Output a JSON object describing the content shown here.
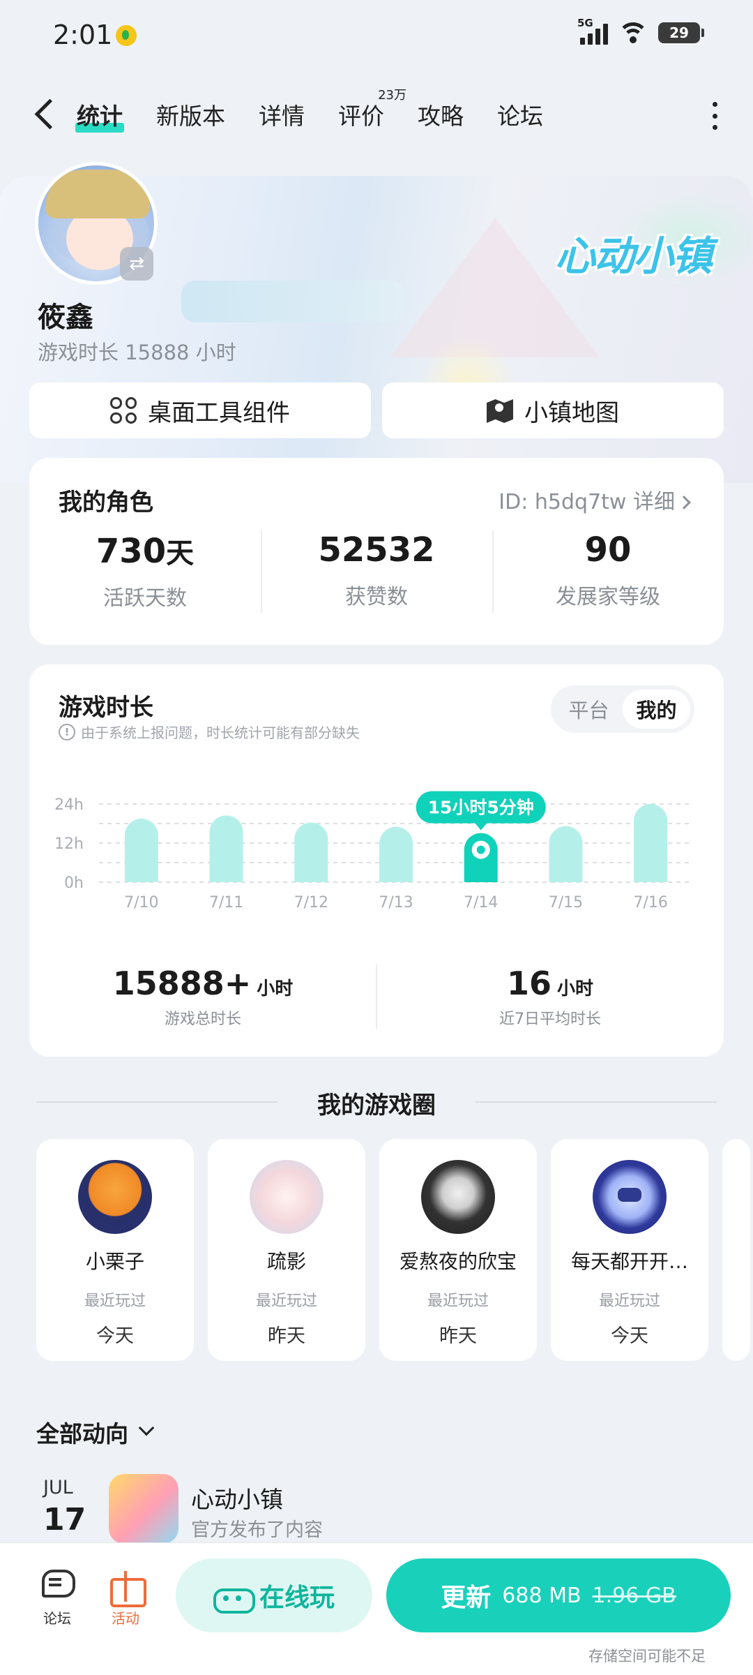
{
  "status_bar": {
    "time": "2:01",
    "network": "5G",
    "battery": "29"
  },
  "nav": {
    "tabs": [
      {
        "label": "统计",
        "active": true
      },
      {
        "label": "新版本"
      },
      {
        "label": "详情"
      },
      {
        "label": "评价",
        "badge": "23万"
      },
      {
        "label": "攻略"
      },
      {
        "label": "论坛"
      }
    ]
  },
  "profile": {
    "name": "筱鑫",
    "playtime": "游戏时长 15888 小时",
    "game_logo": "心动小镇"
  },
  "quick_actions": {
    "widgets": "桌面工具组件",
    "map": "小镇地图"
  },
  "role": {
    "title": "我的角色",
    "id_link": "ID: h5dq7tw 详细",
    "stats": [
      {
        "value": "730",
        "unit": "天",
        "label": "活跃天数"
      },
      {
        "value": "52532",
        "unit": "",
        "label": "获赞数"
      },
      {
        "value": "90",
        "unit": "",
        "label": "发展家等级"
      }
    ]
  },
  "play_time": {
    "title": "游戏时长",
    "note": "由于系统上报问题，时长统计可能有部分缺失",
    "toggle": {
      "platform": "平台",
      "mine": "我的"
    },
    "total_value": "15888+",
    "total_unit": "小时",
    "total_label": "游戏总时长",
    "avg_value": "16",
    "avg_unit": "小时",
    "avg_label": "近7日平均时长"
  },
  "chart_data": {
    "type": "bar",
    "categories": [
      "7/10",
      "7/11",
      "7/12",
      "7/13",
      "7/14",
      "7/15",
      "7/16"
    ],
    "values": [
      19.5,
      20.5,
      18.3,
      17,
      15.08,
      17.2,
      24
    ],
    "ylim": [
      0,
      24
    ],
    "yticks": [
      "0h",
      "12h",
      "24h"
    ],
    "highlight_index": 4,
    "highlight_label": "15小时5分钟",
    "colors": {
      "bar": "#b4f0e9",
      "highlight": "#10d1b9"
    }
  },
  "circle": {
    "title": "我的游戏圈",
    "friends": [
      {
        "name": "小栗子",
        "status": "最近玩过",
        "when": "今天",
        "avatar": "dog-avatar"
      },
      {
        "name": "疏影",
        "status": "最近玩过",
        "when": "昨天",
        "avatar": "girl-avatar"
      },
      {
        "name": "爱熬夜的欣宝",
        "status": "最近玩过",
        "when": "昨天",
        "avatar": "photo-avatar"
      },
      {
        "name": "每天都开开…",
        "status": "最近玩过",
        "when": "今天",
        "avatar": "robot-avatar"
      }
    ]
  },
  "feed": {
    "filter": "全部动向",
    "items": [
      {
        "month": "JUL",
        "day": "17",
        "title": "心动小镇",
        "desc": "官方发布了内容"
      }
    ]
  },
  "bottom_bar": {
    "forum": "论坛",
    "activity": "活动",
    "play_online": "在线玩",
    "update": "更新",
    "update_size": "688 MB",
    "old_size": "1.96 GB",
    "storage_note": "存储空间可能不足"
  }
}
